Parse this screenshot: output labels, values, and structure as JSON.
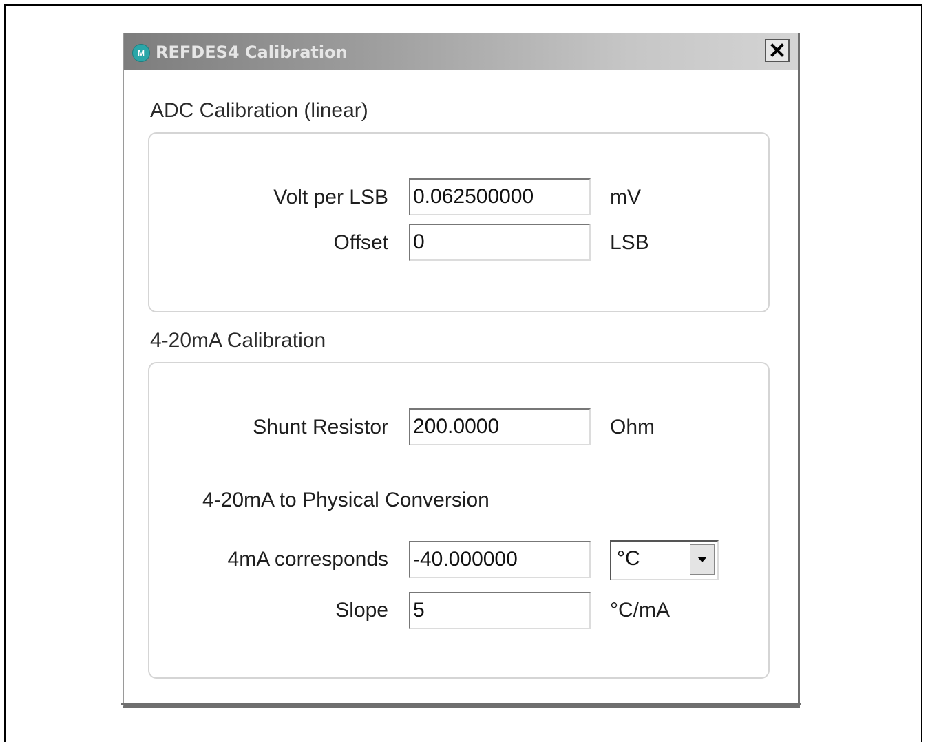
{
  "window": {
    "title": "REFDES4 Calibration",
    "icon": "maxim-logo-icon",
    "close_icon": "close-icon"
  },
  "adc_group": {
    "label": "ADC Calibration (linear)",
    "rows": [
      {
        "label": "Volt per LSB",
        "value": "0.062500000",
        "unit": "mV"
      },
      {
        "label": "Offset",
        "value": "0",
        "unit": "LSB"
      }
    ]
  },
  "ma_group": {
    "label": "4-20mA Calibration",
    "shunt": {
      "label": "Shunt Resistor",
      "value": "200.0000",
      "unit": "Ohm"
    },
    "conversion_label": "4-20mA to Physical Conversion",
    "four_ma": {
      "label": "4mA corresponds",
      "value": "-40.000000",
      "unit_selected": "°C"
    },
    "slope": {
      "label": "Slope",
      "value": "5",
      "unit": "°C/mA"
    }
  }
}
